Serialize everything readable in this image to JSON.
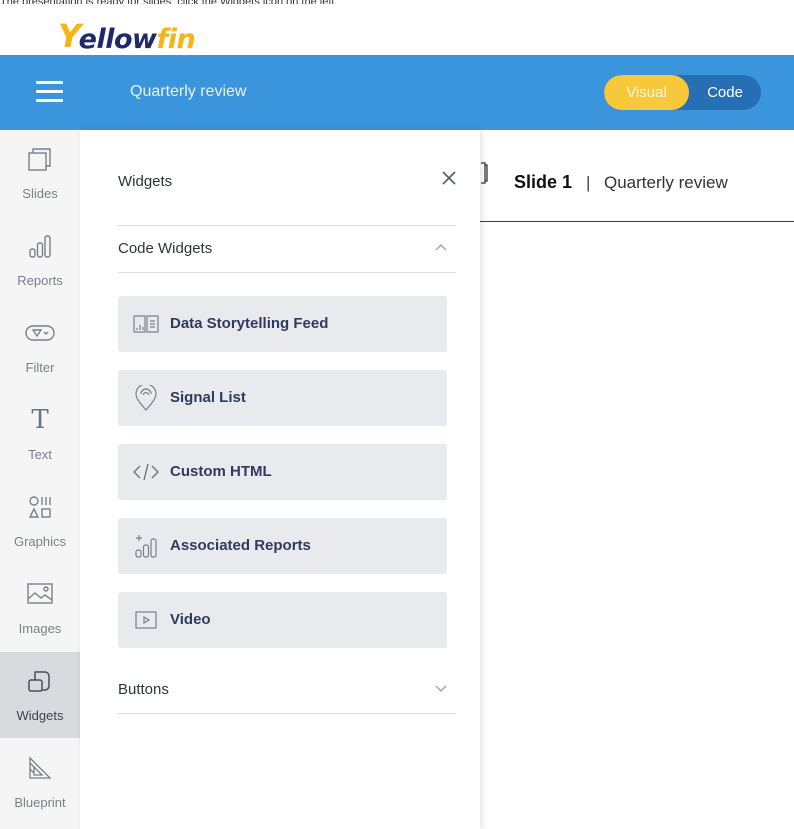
{
  "top_note": "The presentation is ready for slides; click the Widgets icon on the left",
  "app": {
    "brand_initial": "Y",
    "brand_mid": "ellow",
    "brand_end": "fin"
  },
  "header": {
    "title": "Quarterly review",
    "toggle": {
      "visual_label": "Visual",
      "code_label": "Code",
      "active": "Visual"
    }
  },
  "colors": {
    "header_bg": "#3b95dc",
    "toggle_active": "#f7c83a",
    "toggle_bg": "#266fb5",
    "brand_yellow": "#f6b417"
  },
  "rail": {
    "items": [
      {
        "label": "Slides",
        "icon": "slides-icon"
      },
      {
        "label": "Reports",
        "icon": "reports-icon"
      },
      {
        "label": "Filter",
        "icon": "filter-icon"
      },
      {
        "label": "Text",
        "icon": "text-icon"
      },
      {
        "label": "Graphics",
        "icon": "graphics-icon"
      },
      {
        "label": "Images",
        "icon": "images-icon"
      },
      {
        "label": "Widgets",
        "icon": "widgets-icon",
        "active": true
      },
      {
        "label": "Blueprint",
        "icon": "blueprint-icon"
      }
    ]
  },
  "panel": {
    "title": "Widgets",
    "sections": [
      {
        "label": "Code Widgets",
        "expanded": true
      },
      {
        "label": "Buttons",
        "expanded": false
      }
    ],
    "code_widgets": [
      {
        "label": "Data Storytelling Feed",
        "icon": "storytelling-feed-icon"
      },
      {
        "label": "Signal List",
        "icon": "signal-icon"
      },
      {
        "label": "Custom HTML",
        "icon": "code-icon"
      },
      {
        "label": "Associated Reports",
        "icon": "associated-reports-icon"
      },
      {
        "label": "Video",
        "icon": "video-icon"
      }
    ]
  },
  "canvas": {
    "slide_name": "Slide 1",
    "separator": "|",
    "slide_title": "Quarterly review"
  }
}
